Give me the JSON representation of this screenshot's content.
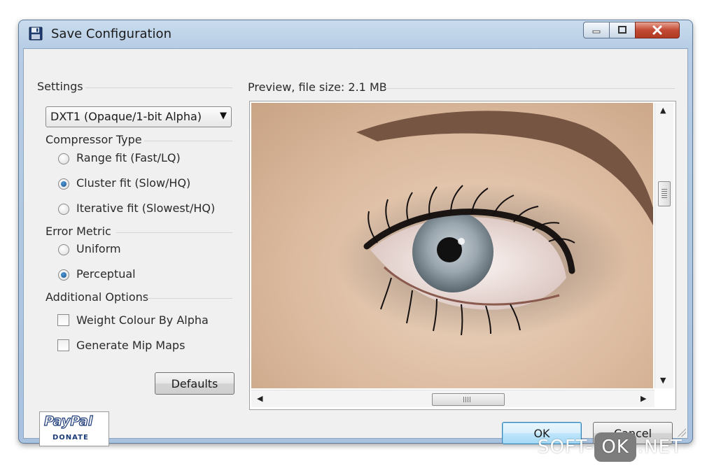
{
  "window": {
    "title": "Save Configuration",
    "controls": {
      "minimize": "minimize-icon",
      "maximize": "maximize-icon",
      "close": "close-icon"
    }
  },
  "settings": {
    "group_label": "Settings",
    "format_dropdown": {
      "selected": "DXT1 (Opaque/1-bit Alpha)"
    }
  },
  "compressor_type": {
    "label": "Compressor Type",
    "options": [
      {
        "label": "Range fit (Fast/LQ)",
        "checked": false
      },
      {
        "label": "Cluster fit (Slow/HQ)",
        "checked": true
      },
      {
        "label": "Iterative fit (Slowest/HQ)",
        "checked": false
      }
    ]
  },
  "error_metric": {
    "label": "Error Metric",
    "options": [
      {
        "label": "Uniform",
        "checked": false
      },
      {
        "label": "Perceptual",
        "checked": true
      }
    ]
  },
  "additional_options": {
    "label": "Additional Options",
    "options": [
      {
        "label": "Weight Colour By Alpha",
        "checked": false
      },
      {
        "label": "Generate Mip Maps",
        "checked": false
      }
    ]
  },
  "buttons": {
    "defaults": "Defaults",
    "ok": "OK",
    "cancel": "Cancel"
  },
  "paypal": {
    "logo": "PayPal",
    "caption": "DONATE"
  },
  "preview": {
    "label": "Preview, file size: 2.1 MB"
  },
  "watermark": {
    "prefix": "SOFT-",
    "highlight": "OK",
    "suffix": ".NET"
  },
  "colors": {
    "title_bar": "#b7cde5",
    "close_button": "#c24a34",
    "default_button": "#bee6fd",
    "skin": "#dcbba0",
    "iris": "#9aa6ae"
  }
}
